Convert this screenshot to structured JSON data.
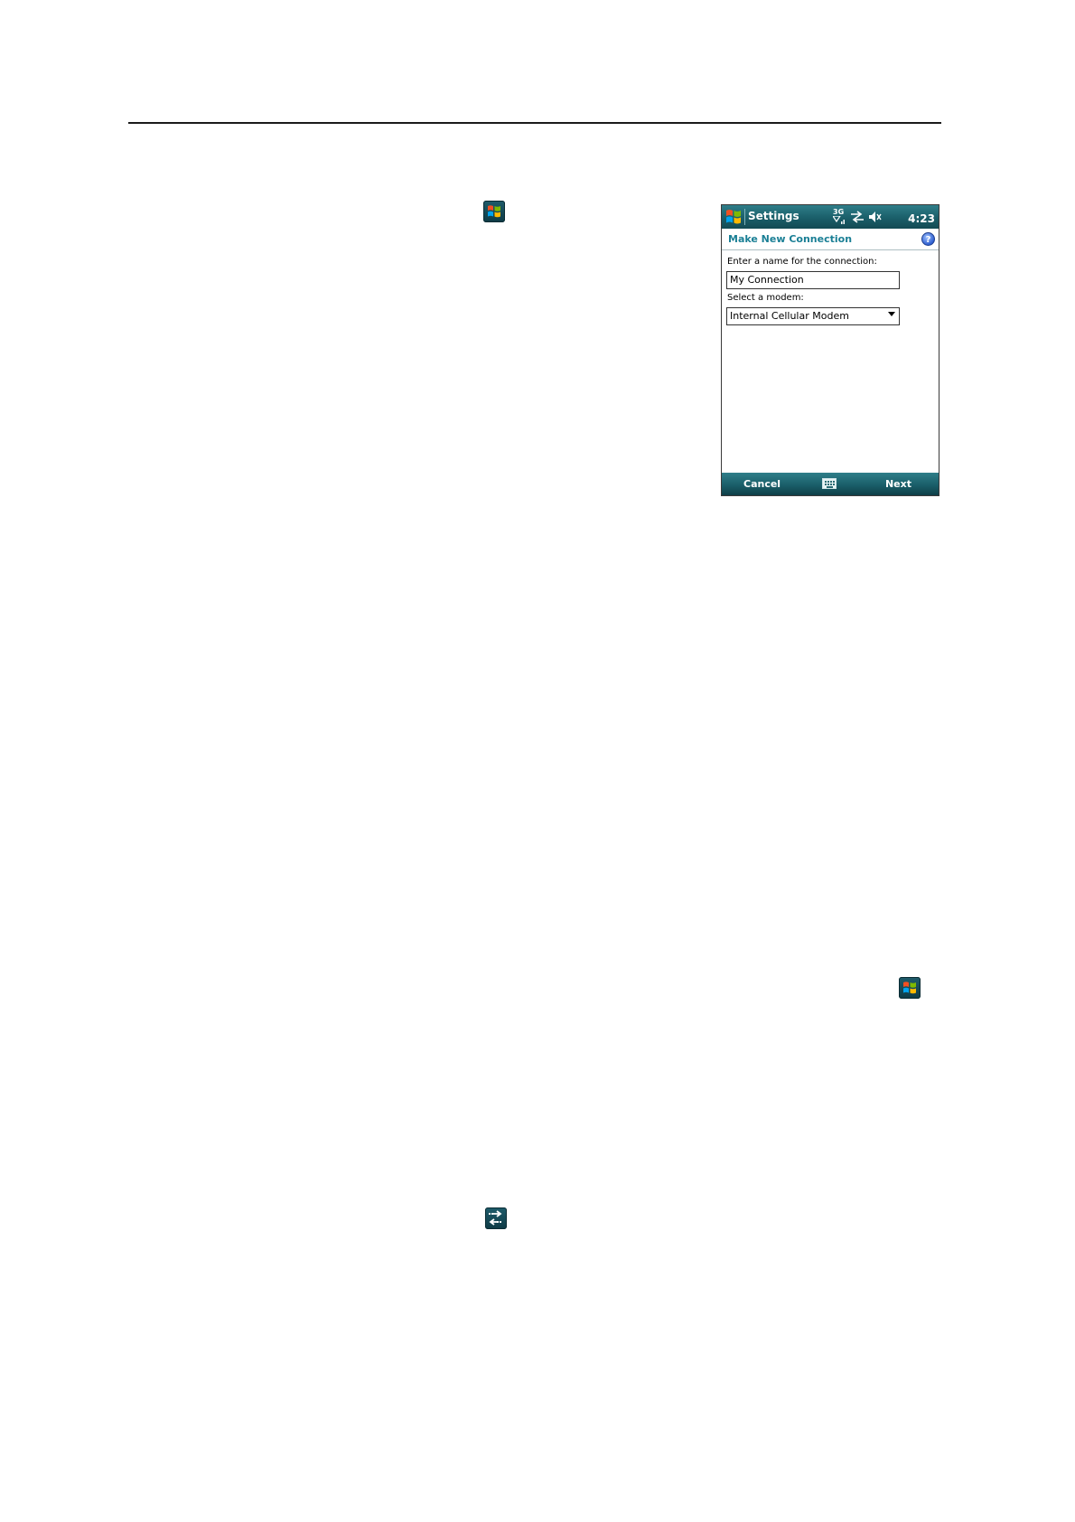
{
  "phone": {
    "titlebar": {
      "title": "Settings",
      "network": "3G",
      "time": "4:23"
    },
    "header": {
      "title": "Make New Connection",
      "help_glyph": "?"
    },
    "form": {
      "name_label": "Enter a name for the connection:",
      "name_value": "My Connection",
      "modem_label": "Select a modem:",
      "modem_value": "Internal Cellular Modem"
    },
    "softkeys": {
      "left": "Cancel",
      "right": "Next"
    }
  },
  "icons": {
    "start": "windows-start-icon",
    "connectivity": "connectivity-arrows-icon"
  },
  "colors": {
    "accent": "#1a7f95",
    "bar_top": "#2f7e89",
    "bar_bottom": "#134a53"
  }
}
